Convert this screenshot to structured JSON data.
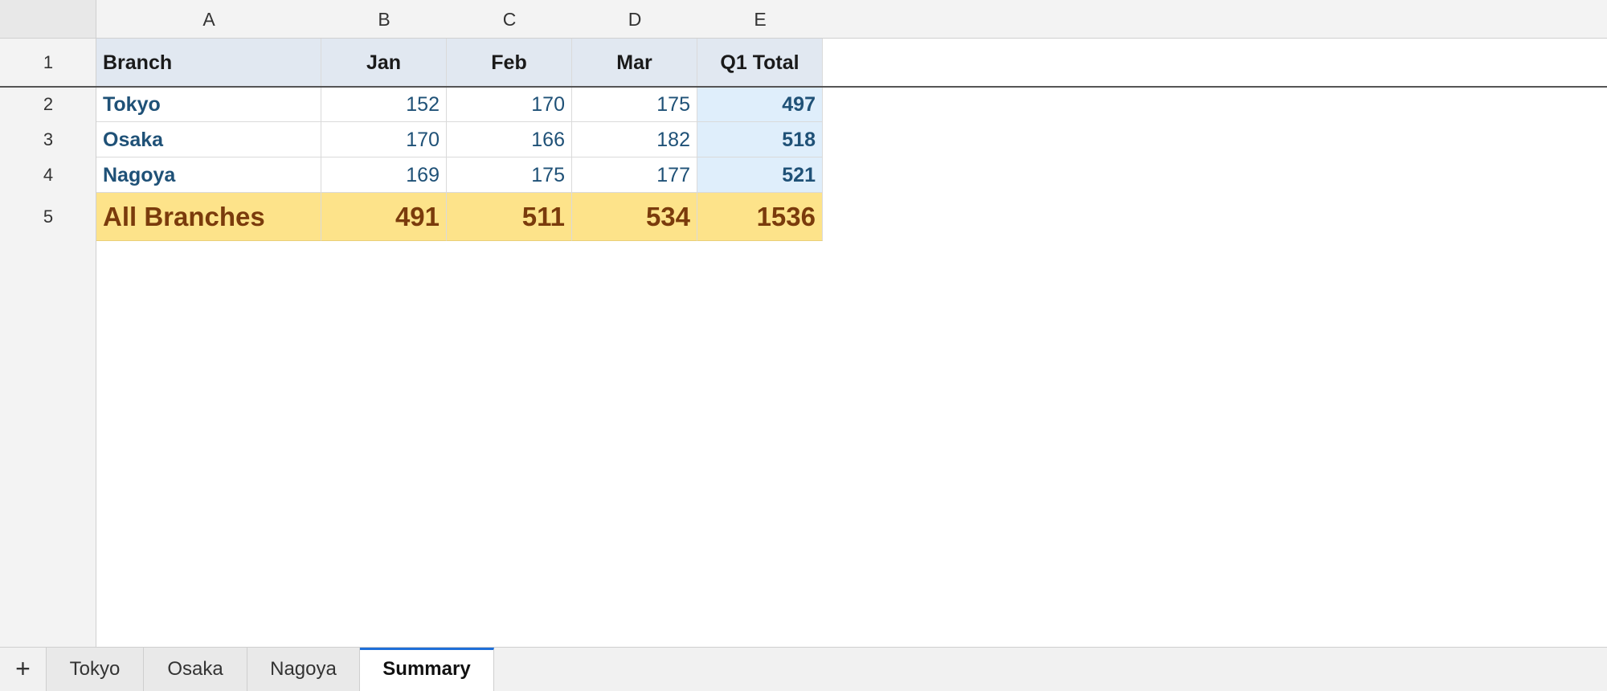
{
  "columns": [
    "A",
    "B",
    "C",
    "D",
    "E"
  ],
  "rows": [
    "1",
    "2",
    "3",
    "4",
    "5"
  ],
  "header": {
    "branch": "Branch",
    "jan": "Jan",
    "feb": "Feb",
    "mar": "Mar",
    "total": "Q1 Total"
  },
  "data": [
    {
      "branch": "Tokyo",
      "jan": "152",
      "feb": "170",
      "mar": "175",
      "total": "497"
    },
    {
      "branch": "Osaka",
      "jan": "170",
      "feb": "166",
      "mar": "182",
      "total": "518"
    },
    {
      "branch": "Nagoya",
      "jan": "169",
      "feb": "175",
      "mar": "177",
      "total": "521"
    }
  ],
  "summary": {
    "branch": "All Branches",
    "jan": "491",
    "feb": "511",
    "mar": "534",
    "total": "1536"
  },
  "sheet_tabs": {
    "add_symbol": "+",
    "tabs": [
      {
        "label": "Tokyo",
        "active": false
      },
      {
        "label": "Osaka",
        "active": false
      },
      {
        "label": "Nagoya",
        "active": false
      },
      {
        "label": "Summary",
        "active": true
      }
    ]
  },
  "colors": {
    "header_fill": "#e1e8f1",
    "total_column_fill": "#dfeefb",
    "summary_fill": "#fde38a",
    "summary_text": "#7a3b0c",
    "body_text": "#1f5177",
    "active_tab_accent": "#1f6fd8"
  },
  "icons": {
    "add_sheet": "plus-icon"
  }
}
